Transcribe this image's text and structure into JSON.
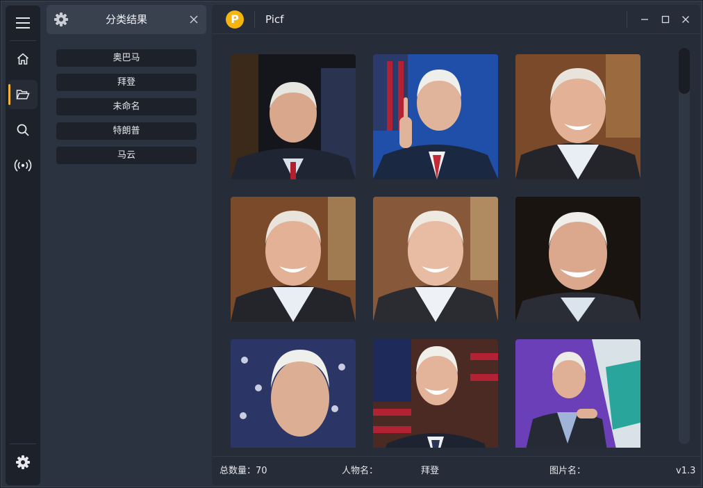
{
  "rail": {
    "items": [
      {
        "icon": "menu-icon"
      },
      {
        "icon": "home-icon"
      },
      {
        "icon": "folder-open-icon",
        "active": true
      },
      {
        "icon": "search-icon"
      },
      {
        "icon": "broadcast-icon"
      },
      {
        "icon": "settings-icon"
      }
    ],
    "accent": "#f3b53a"
  },
  "panel": {
    "title": "分类结果",
    "categories": [
      "奥巴马",
      "拜登",
      "未命名",
      "特朗普",
      "马云"
    ]
  },
  "titlebar": {
    "logo_letter": "P",
    "app_name": "Picf",
    "logo_color": "#f5b40e"
  },
  "status": {
    "total_label": "总数量：",
    "total_value": "70",
    "person_label": "人物名：",
    "person_value": "拜登",
    "image_label": "图片名：",
    "image_value": "",
    "version": "v1.3"
  }
}
